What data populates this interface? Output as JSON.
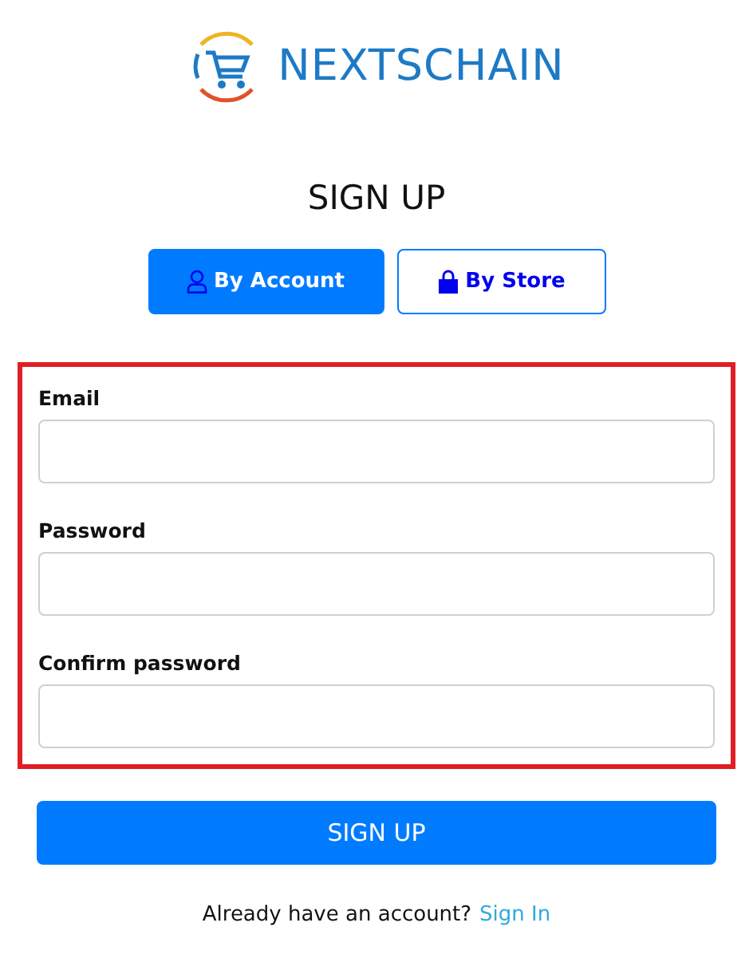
{
  "logo": {
    "text": "NEXTSCHAIN"
  },
  "title": "SIGN UP",
  "tabs": [
    {
      "label": "By Account",
      "kind": "account",
      "selected": true
    },
    {
      "label": "By Store",
      "kind": "store",
      "selected": false
    }
  ],
  "fields": [
    {
      "label": "Email"
    },
    {
      "label": "Password"
    },
    {
      "label": "Confirm password"
    }
  ],
  "submit": "SIGN UP",
  "footer": {
    "text": "Already have an account?",
    "link": "Sign In"
  }
}
